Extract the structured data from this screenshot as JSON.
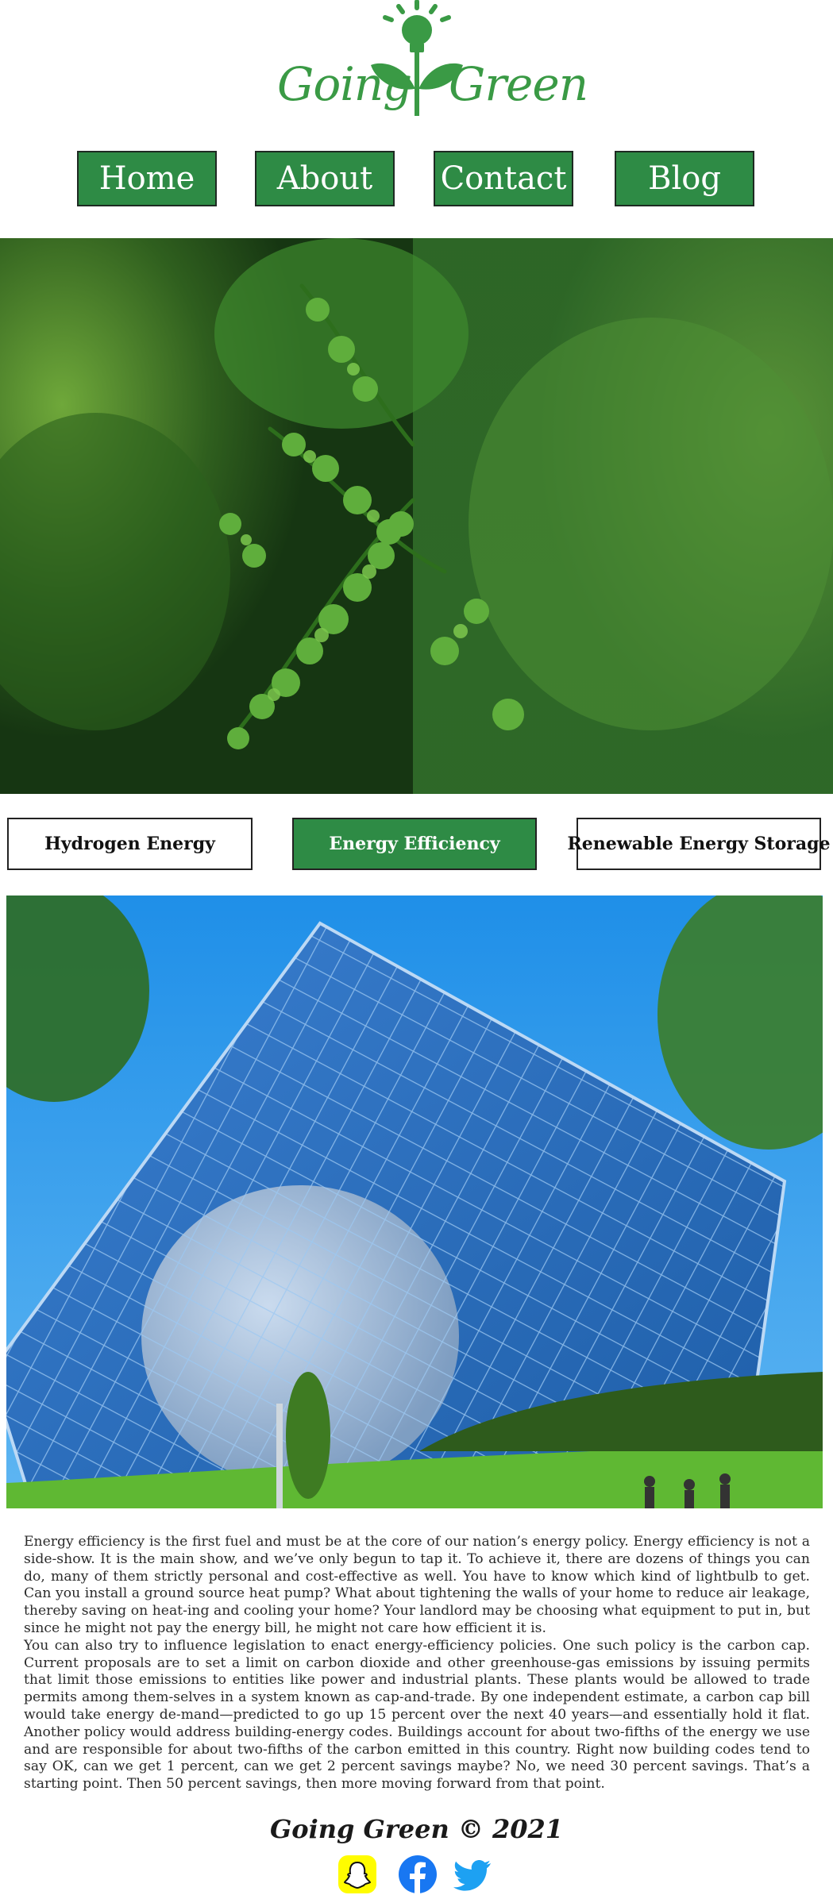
{
  "brand": {
    "logo_word_1": "Going",
    "logo_word_2": "Green",
    "accent_color": "#2e8b45",
    "logo_color": "#3a9a45"
  },
  "nav": {
    "items": [
      {
        "label": "Home"
      },
      {
        "label": "About"
      },
      {
        "label": "Contact"
      },
      {
        "label": "Blog"
      }
    ]
  },
  "tabs": {
    "items": [
      {
        "label": "Hydrogen Energy",
        "active": false
      },
      {
        "label": "Energy Efficiency",
        "active": true
      },
      {
        "label": "Renewable Energy Storage",
        "active": false
      }
    ]
  },
  "article": {
    "paragraphs": [
      "Energy efficiency is the first fuel and must be at the core of our nation’s energy policy. Energy efficiency is not a side-show. It is the main show, and we’ve only begun to tap it. To achieve it, there are dozens of things you can do, many of them strictly personal and cost-effective as well. You have to know which kind of lightbulb to get. Can you install a ground source heat pump? What about tightening the walls of your home to reduce air leakage, thereby saving on heat-ing and cooling your home? Your landlord may be choosing what equipment to put in, but since he might not pay the energy bill, he might not care how efficient it is.",
      "You can also try to influence legislation to enact energy-efficiency policies. One such policy is the carbon cap. Current proposals are to set a limit on carbon dioxide and other greenhouse-gas emissions by issuing permits that limit those emissions to entities like power and industrial plants. These plants would be allowed to trade permits among them-selves in a system known as cap-and-trade. By one independent estimate, a carbon cap bill would take energy de-mand—predicted to go up 15 percent over the next 40 years—and essentially hold it flat. Another policy would address building-energy codes. Buildings account for about two-fifths of the energy we use and are responsible for about two-fifths of the carbon emitted in this country. Right now building codes tend to say OK, can we get 1 percent, can we get 2 percent savings maybe? No, we need 30 percent savings. That’s a starting point. Then 50 percent savings, then more moving forward from that point."
    ]
  },
  "footer": {
    "title": "Going Green © 2021",
    "social": [
      {
        "icon": "snapchat-icon",
        "color": "#FFFC00"
      },
      {
        "icon": "facebook-icon",
        "color": "#1877F2"
      },
      {
        "icon": "twitter-icon",
        "color": "#1DA1F2"
      }
    ]
  }
}
